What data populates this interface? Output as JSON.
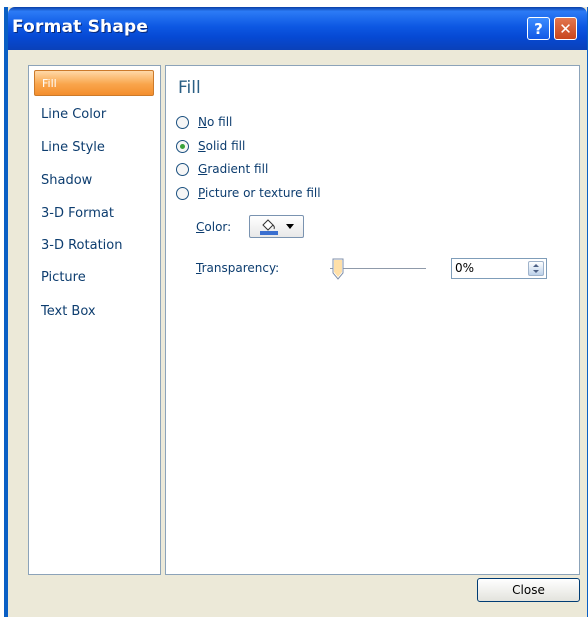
{
  "window": {
    "title": "Format Shape",
    "help_button": "?",
    "close_button": "✕"
  },
  "sidebar": {
    "items": [
      {
        "label": "Fill",
        "selected": true
      },
      {
        "label": "Line Color"
      },
      {
        "label": "Line Style"
      },
      {
        "label": "Shadow"
      },
      {
        "label": "3-D Format"
      },
      {
        "label": "3-D Rotation"
      },
      {
        "label": "Picture"
      },
      {
        "label": "Text Box"
      }
    ]
  },
  "fill_panel": {
    "section_title": "Fill",
    "options": [
      {
        "label": "No fill",
        "checked": false
      },
      {
        "label": "Solid fill",
        "checked": true
      },
      {
        "label": "Gradient fill",
        "checked": false
      },
      {
        "label": "Picture or texture fill",
        "checked": false
      }
    ],
    "color_label": "Color:",
    "color_value": "#3a6fd0",
    "transparency_label": "Transparency:",
    "transparency_value": "0%"
  },
  "footer": {
    "close_label": "Close"
  },
  "colors": {
    "titlebar_blue": "#0d58e3",
    "selected_orange": "#f9a54b",
    "dialog_bg": "#ece9d8"
  }
}
